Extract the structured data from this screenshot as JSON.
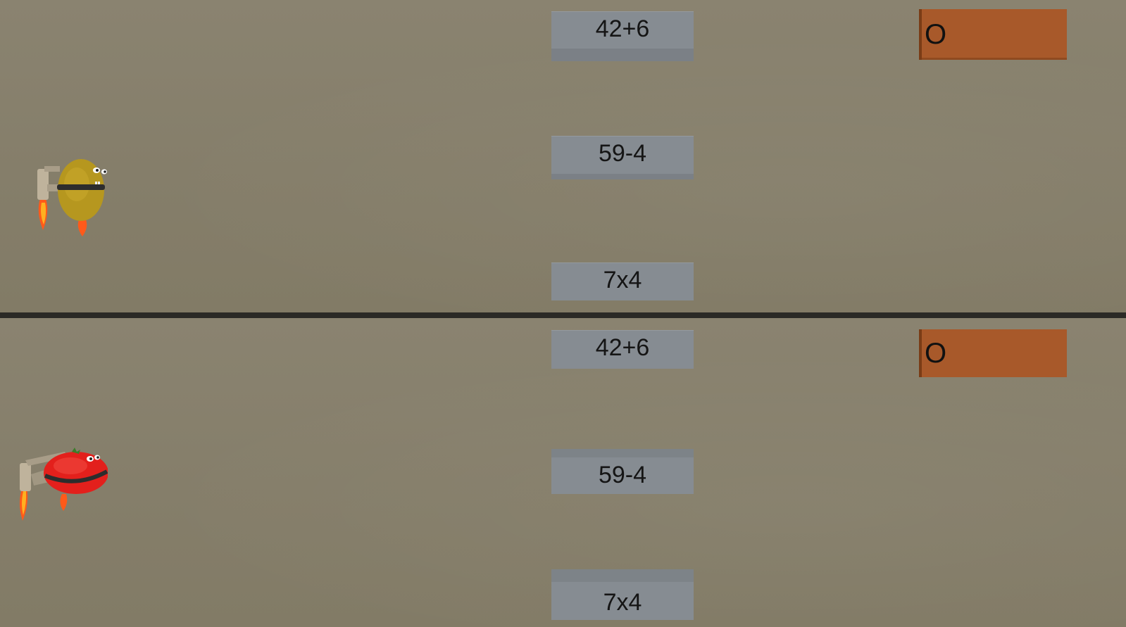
{
  "players": [
    {
      "id": "top",
      "character": "potato-jetpack",
      "answer_blocks": [
        "42+6",
        "59-4",
        "7x4"
      ],
      "score_text": "O"
    },
    {
      "id": "bottom",
      "character": "tomato-jetpack",
      "answer_blocks": [
        "42+6",
        "59-4",
        "7x4"
      ],
      "score_text": "O"
    }
  ],
  "colors": {
    "background": "#878068",
    "block": "#868c92",
    "score_box": "#a8592a",
    "divider": "#2b2a26"
  }
}
